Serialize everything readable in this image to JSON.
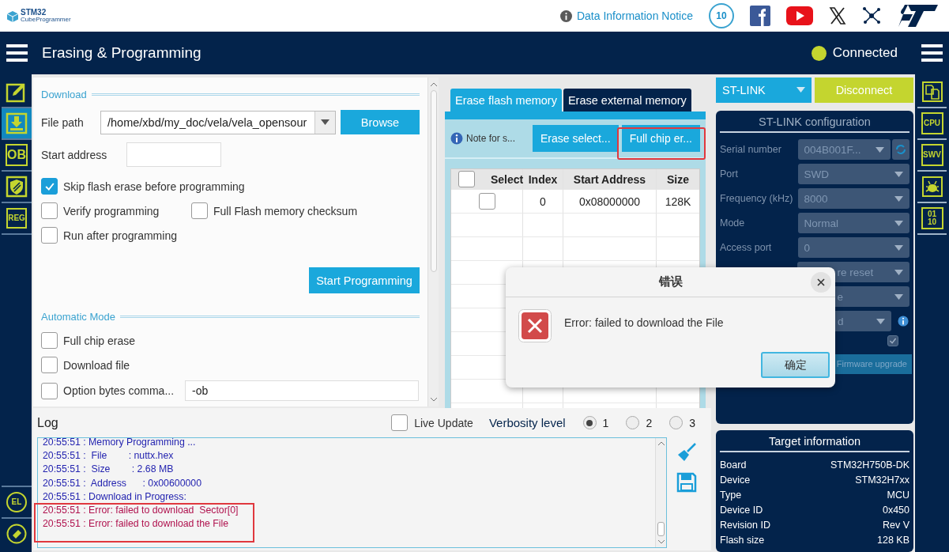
{
  "header": {
    "logo_top": "STM32",
    "logo_bottom": "CubeProgrammer",
    "notice_link": "Data Information Notice",
    "badge": "10"
  },
  "navbar": {
    "title": "Erasing & Programming",
    "status": "Connected",
    "connected": true
  },
  "left_rail": [
    {
      "kind": "edit",
      "selected": false
    },
    {
      "kind": "download",
      "selected": true
    },
    {
      "kind": "text",
      "label": "OB",
      "selected": false
    },
    {
      "kind": "shield",
      "selected": false
    },
    {
      "kind": "text-small",
      "label": "REG",
      "selected": false
    }
  ],
  "left_rail_bottom": [
    {
      "kind": "chip",
      "label": "EL"
    },
    {
      "kind": "eraser"
    }
  ],
  "download": {
    "title": "Download",
    "file_path_label": "File path",
    "file_path": "/home/xbd/my_doc/vela/vela_opensour",
    "browse": "Browse",
    "start_address_label": "Start address",
    "option_rows": [
      [
        {
          "label": "Skip flash erase before programming",
          "checked": true
        }
      ],
      [
        {
          "label": "Verify programming",
          "checked": false
        },
        {
          "label": "Full Flash memory checksum",
          "checked": false
        }
      ],
      [
        {
          "label": "Run after programming",
          "checked": false
        }
      ]
    ],
    "start_button": "Start Programming"
  },
  "automatic_mode": {
    "title": "Automatic Mode",
    "options": [
      {
        "label": "Full chip erase",
        "checked": false
      },
      {
        "label": "Download file",
        "checked": false
      },
      {
        "label": "Option bytes comma...",
        "checked": false
      }
    ],
    "option_bytes_command": "-ob"
  },
  "erase": {
    "tabs": [
      {
        "label": "Erase flash memory",
        "selected": true
      },
      {
        "label": "Erase external memory",
        "selected": false
      }
    ],
    "note": "Note for s...",
    "buttons": [
      "Erase select...",
      "Full chip er..."
    ],
    "table": {
      "select_all_checked": false,
      "columns": [
        "Select",
        "Index",
        "Start Address",
        "Size"
      ],
      "rows": [
        {
          "checked": false,
          "index": "0",
          "start_address": "0x08000000",
          "size": "128K"
        }
      ]
    }
  },
  "connection": {
    "interface": "ST-LINK",
    "disconnect": "Disconnect"
  },
  "config": {
    "title": "ST-LINK configuration",
    "disabled": true,
    "fields": [
      {
        "kind": "dropdown-refresh",
        "label": "Serial number",
        "value": "004B001F..."
      },
      {
        "kind": "dropdown",
        "label": "Port",
        "value": "SWD"
      },
      {
        "kind": "dropdown",
        "label": "Frequency (kHz)",
        "value": "8000"
      },
      {
        "kind": "dropdown",
        "label": "Mode",
        "value": "Normal"
      },
      {
        "kind": "dropdown",
        "label": "Access port",
        "value": "0"
      },
      {
        "kind": "dropdown",
        "value": "re reset"
      },
      {
        "kind": "dropdown",
        "value": "e"
      },
      {
        "kind": "dropdown-info",
        "value": "d"
      },
      {
        "kind": "check",
        "checked": true
      }
    ],
    "firmware_button": "Firmware upgrade"
  },
  "target": {
    "title": "Target information",
    "rows": [
      {
        "label": "Board",
        "value": "STM32H750B-DK"
      },
      {
        "label": "Device",
        "value": "STM32H7xx"
      },
      {
        "label": "Type",
        "value": "MCU"
      },
      {
        "label": "Device ID",
        "value": "0x450"
      },
      {
        "label": "Revision ID",
        "value": "Rev V"
      },
      {
        "label": "Flash size",
        "value": "128 KB"
      }
    ]
  },
  "right_rail": [
    {
      "kind": "docs"
    },
    {
      "kind": "text",
      "label": "CPU"
    },
    {
      "kind": "text",
      "label": "SWV"
    },
    {
      "kind": "bug"
    },
    {
      "kind": "text",
      "label": "01\n10"
    }
  ],
  "log": {
    "title": "Log",
    "live_update": {
      "label": "Live Update",
      "checked": false
    },
    "verbosity_label": "Verbosity level",
    "levels": [
      {
        "label": "1",
        "selected": true
      },
      {
        "label": "2",
        "selected": false
      },
      {
        "label": "3",
        "selected": false
      }
    ],
    "lines": [
      {
        "kind": "info",
        "text": "20:55:51 : Memory Programming ..."
      },
      {
        "kind": "info",
        "text": "20:55:51 :  File        : nuttx.hex"
      },
      {
        "kind": "info",
        "text": "20:55:51 :  Size        : 2.68 MB"
      },
      {
        "kind": "info",
        "text": "20:55:51 :  Address      : 0x00600000"
      },
      {
        "kind": "info",
        "text": "20:55:51 : Download in Progress:"
      },
      {
        "kind": "error",
        "text": "20:55:51 : Error: failed to download  Sector[0]"
      },
      {
        "kind": "error",
        "text": "20:55:51 : Error: failed to download the File"
      }
    ]
  },
  "dialog": {
    "title": "错误",
    "message": "Error: failed to download the File",
    "ok": "确定"
  }
}
